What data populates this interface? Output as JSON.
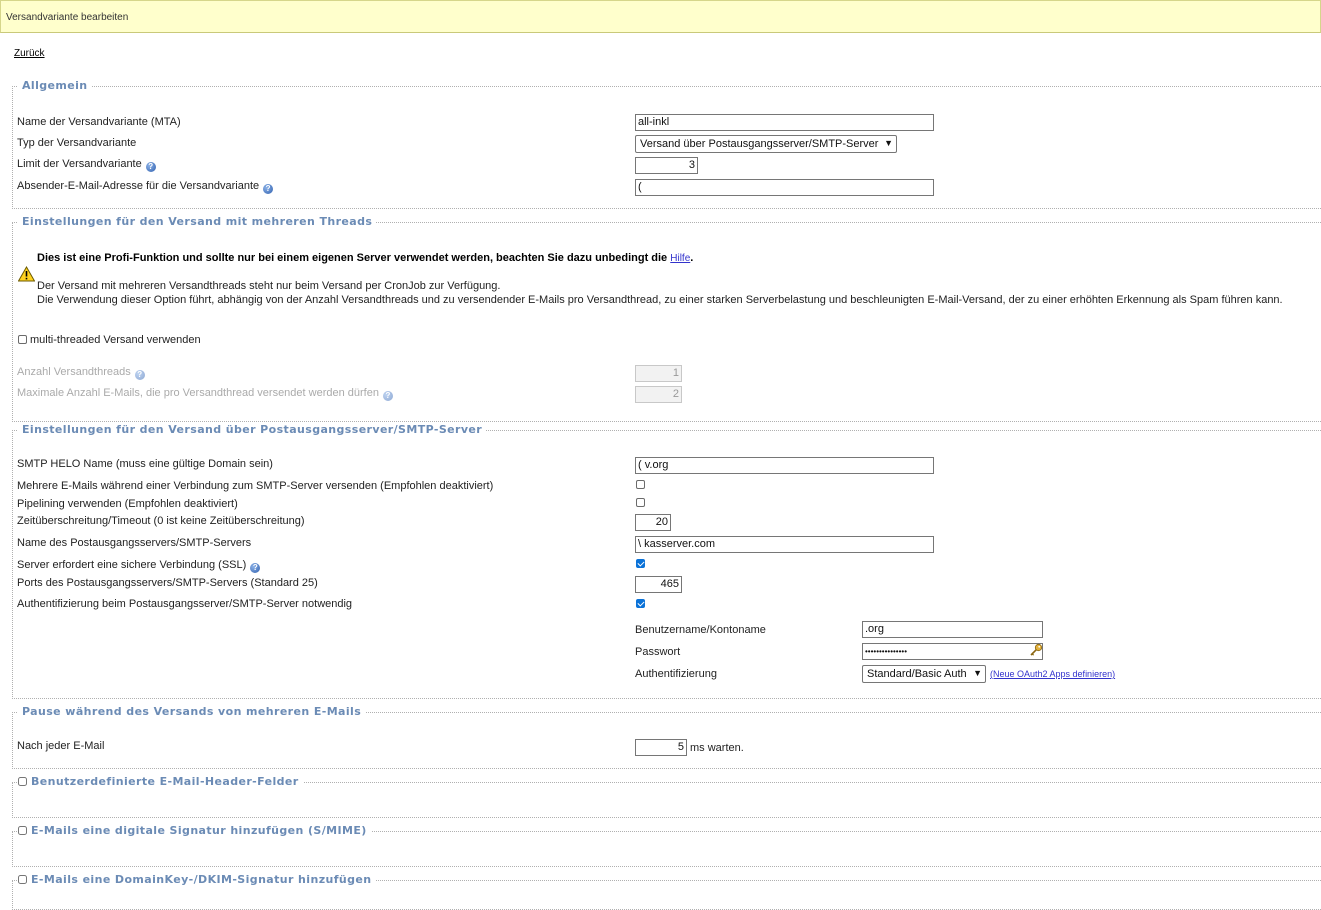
{
  "title": "Versandvariante bearbeiten",
  "back_link": "Zurück",
  "general": {
    "legend": "Allgemein",
    "name_label": "Name der Versandvariante (MTA)",
    "name_value": "all-inkl",
    "type_label": "Typ der Versandvariante",
    "type_value": "Versand über Postausgangsserver/SMTP-Server",
    "limit_label": "Limit der Versandvariante",
    "limit_value": "3",
    "sender_label": "Absender-E-Mail-Adresse für die Versandvariante",
    "sender_value": "("
  },
  "threads": {
    "legend": "Einstellungen für den Versand mit mehreren Threads",
    "warning_bold": "Dies ist eine Profi-Funktion und sollte nur bei einem eigenen Server verwendet werden, beachten Sie dazu unbedingt die",
    "warning_link": "Hilfe",
    "warning_line1": "Der Versand mit mehreren Versandthreads steht nur beim Versand per CronJob zur Verfügung.",
    "warning_line2": "Die Verwendung dieser Option führt, abhängig von der Anzahl Versandthreads und zu versendender E-Mails pro Versandthread, zu einer starken Serverbelastung und beschleunigten E-Mail-Versand, der zu einer erhöhten Erkennung als Spam führen kann.",
    "multithread_label": "multi-threaded Versand verwenden",
    "multithread_checked": false,
    "count_label": "Anzahl Versandthreads",
    "count_value": "1",
    "max_label": "Maximale Anzahl E-Mails, die pro Versandthread versendet werden dürfen",
    "max_value": "2"
  },
  "smtp": {
    "legend": "Einstellungen für den Versand über Postausgangsserver/SMTP-Server",
    "helo_label": "SMTP HELO Name (muss eine gültige Domain sein)",
    "helo_value": "(        v.org",
    "multi_label": "Mehrere E-Mails während einer Verbindung zum SMTP-Server versenden (Empfohlen deaktiviert)",
    "multi_checked": false,
    "pipelining_label": "Pipelining verwenden (Empfohlen deaktiviert)",
    "pipelining_checked": false,
    "timeout_label": "Zeitüberschreitung/Timeout (0 ist keine Zeitüberschreitung)",
    "timeout_value": "20",
    "server_label": "Name des Postausgangsservers/SMTP-Servers",
    "server_value": "\\               kasserver.com",
    "ssl_label": "Server erfordert eine sichere Verbindung (SSL)",
    "ssl_checked": true,
    "port_label": "Ports des Postausgangsservers/SMTP-Servers (Standard 25)",
    "port_value": "465",
    "auth_label": "Authentifizierung beim Postausgangsserver/SMTP-Server notwendig",
    "auth_checked": true,
    "user_label": "Benutzername/Kontoname",
    "user_value": "                        .org",
    "password_label": "Passwort",
    "password_value": "•••••••••••••••",
    "authtype_label": "Authentifizierung",
    "authtype_value": "Standard/Basic Auth",
    "oauth_link": "(Neue OAuth2 Apps definieren)"
  },
  "pause": {
    "legend": "Pause während des Versands von mehreren E-Mails",
    "after_label": "Nach jeder E-Mail",
    "after_value": "5",
    "unit": "ms warten."
  },
  "custom_headers": {
    "legend": "Benutzerdefinierte E-Mail-Header-Felder",
    "checked": false
  },
  "smime": {
    "legend": "E-Mails eine digitale Signatur hinzufügen (S/MIME)",
    "checked": false
  },
  "dkim": {
    "legend": "E-Mails eine DomainKey-/DKIM-Signatur hinzufügen",
    "checked": false
  },
  "icons": {
    "help": "help-icon",
    "warning": "warning-icon",
    "key": "key-icon",
    "dropdown": "chevron-down-icon"
  },
  "colors": {
    "titlebar_bg": "#ffffcc",
    "legend": "#6b8bb5",
    "checkbox_checked": "#0a72d8",
    "link": "#3333cc"
  }
}
